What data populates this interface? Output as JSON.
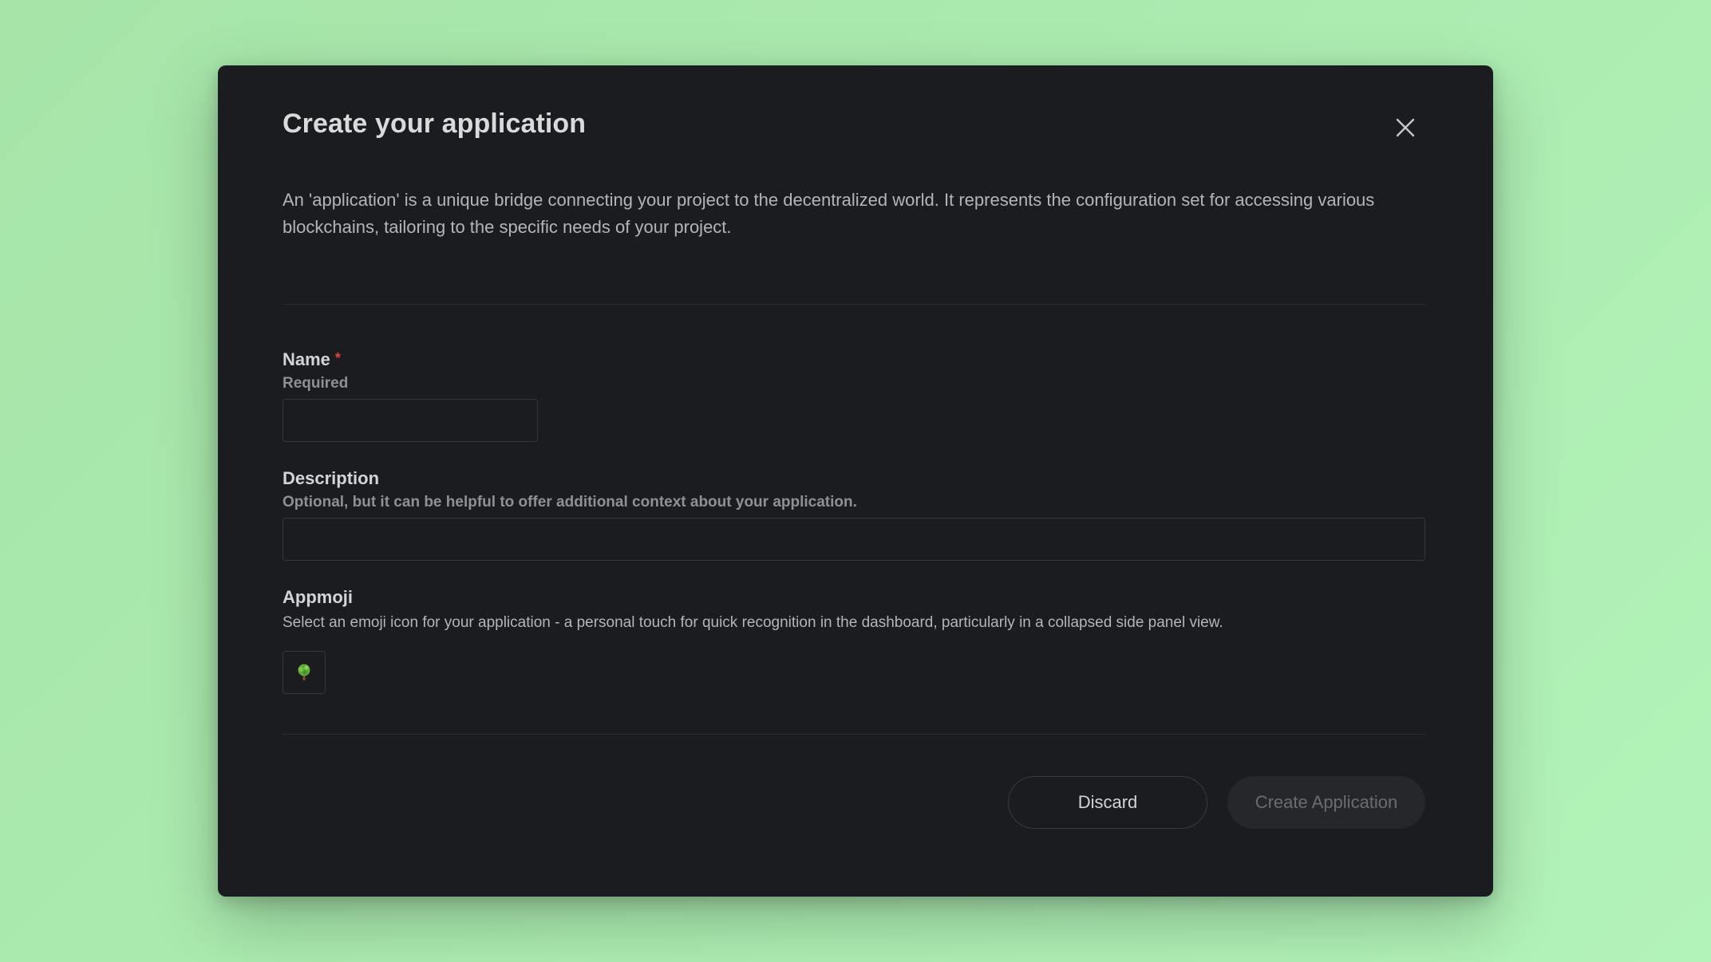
{
  "modal": {
    "title": "Create your application",
    "intro": "An 'application' is a unique bridge connecting your project to the decentralized world. It represents the configuration set for accessing various blockchains, tailoring to the specific needs of your project."
  },
  "fields": {
    "name": {
      "label": "Name",
      "required_mark": "*",
      "help": "Required",
      "value": "",
      "placeholder": ""
    },
    "description": {
      "label": "Description",
      "help": "Optional, but it can be helpful to offer additional context about your application.",
      "value": "",
      "placeholder": ""
    },
    "appmoji": {
      "label": "Appmoji",
      "help": "Select an emoji icon for your application - a personal touch for quick recognition in the dashboard, particularly in a collapsed side panel view.",
      "selected_icon": "tree-icon"
    }
  },
  "actions": {
    "discard_label": "Discard",
    "create_label": "Create Application",
    "create_disabled": true
  },
  "colors": {
    "background": "#a6e4a8",
    "modal": "#1b1c1f",
    "required": "#e0443e"
  }
}
